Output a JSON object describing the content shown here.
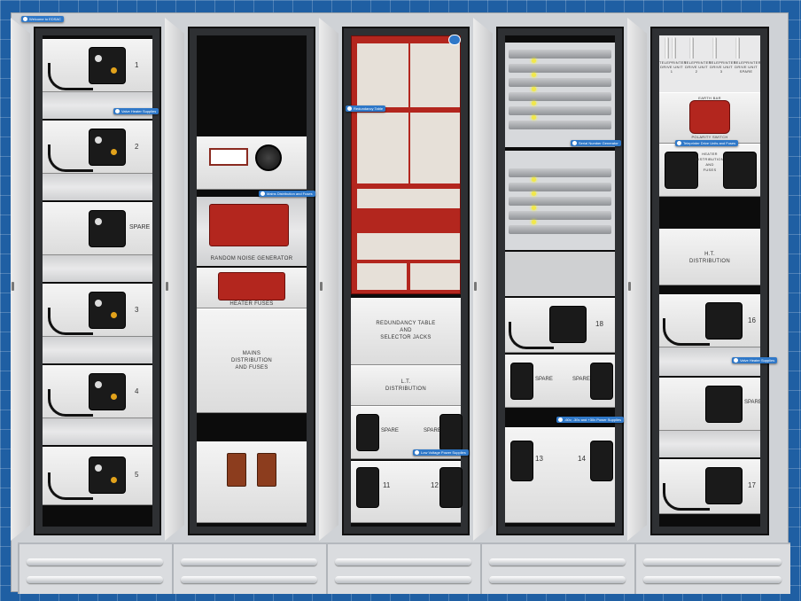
{
  "colors": {
    "background": "#1f5fa3",
    "tag": "#2f78c8",
    "panel": "#e8e8e8",
    "chassis": "#b3261e"
  },
  "tags": {
    "welcome": "Welcome to EDSAC",
    "valve_heater_supplies_1": "Valve Heater Supplies",
    "mains_distribution": "Mains Distribution and Fuses",
    "redundancy_table": "Redundancy Table",
    "low_voltage_supplies": "Low Voltage Power Supplies",
    "serial_number_generator": "Serial Number Generator",
    "valve_supplies_2": "-60v, -30v and +30v Power Supplies",
    "teleprinter_drive": "Teleprinter Drive Units and Fuses",
    "valve_heater_supplies_2": "Valve Heater Supplies"
  },
  "bay1": {
    "labels": [
      "1",
      "2",
      "SPARE",
      "3",
      "4",
      "5"
    ]
  },
  "bay2": {
    "noise_generator": "RANDOM NOISE GENERATOR",
    "heater_fuses": "HEATER FUSES",
    "mains": "MAINS\nDISTRIBUTION\nAND FUSES"
  },
  "bay3": {
    "redundancy": "REDUNDANCY TABLE\nAND\nSELECTOR JACKS",
    "lt": "L.T.\nDISTRIBUTION",
    "spare_left": "SPARE",
    "spare_right": "SPARE",
    "unit_11": "11",
    "unit_12": "12"
  },
  "bay4": {
    "unit_18": "18",
    "spare_left": "SPARE",
    "spare_right": "SPARE",
    "unit_13": "13",
    "unit_14": "14"
  },
  "bay5": {
    "teleprinters": [
      "TELEPRINTER DRIVE UNIT 1",
      "TELEPRINTER DRIVE UNIT 2",
      "TELEPRINTER DRIVE UNIT 3",
      "TELEPRINTER DRIVE UNIT SPARE"
    ],
    "earth_bar": "EARTH BAR",
    "polarity": "POLARITY SWITCH",
    "heater": "HEATER\nDISTRIBUTION\nAND\nFUSES",
    "ht": "H.T.\nDISTRIBUTION",
    "unit_16": "16",
    "spare": "SPARE",
    "unit_17": "17"
  }
}
